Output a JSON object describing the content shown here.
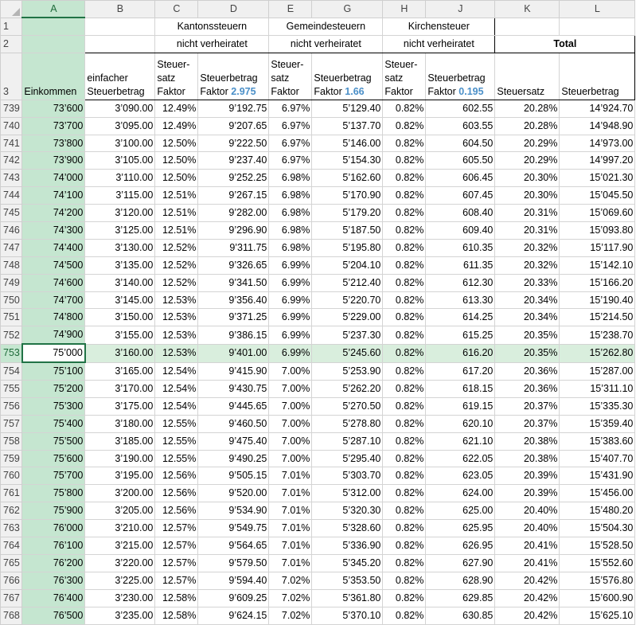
{
  "sheet": {
    "columns": [
      "A",
      "B",
      "C",
      "D",
      "E",
      "G",
      "H",
      "J",
      "K",
      "L"
    ],
    "header_rows": [
      "1",
      "2",
      "3"
    ],
    "group_titles": {
      "kanton": "Kantonssteuern",
      "gemeinde": "Gemeindesteuern",
      "kirche": "Kirchensteuer"
    },
    "group_subtitle": "nicht verheiratet",
    "total_label": "Total",
    "headers": {
      "einkommen": "Einkommen",
      "einfach_1": "einfacher",
      "einfach_2": "Steuerbetrag",
      "satz_1": "Steuer-",
      "satz_2": "satz",
      "satz_3": "Faktor",
      "betrag_1": "Steuerbetrag",
      "betrag_2": "Faktor",
      "faktor_kanton": "2.975",
      "faktor_gemeinde": "1.66",
      "faktor_kirche": "0.195",
      "steuersatz": "Steuersatz",
      "steuerbetrag": "Steuerbetrag"
    },
    "active_row": "753",
    "rows": [
      [
        "739",
        "73’600",
        "3’090.00",
        "12.49%",
        "9’192.75",
        "6.97%",
        "5’129.40",
        "0.82%",
        "602.55",
        "20.28%",
        "14’924.70"
      ],
      [
        "740",
        "73’700",
        "3’095.00",
        "12.49%",
        "9’207.65",
        "6.97%",
        "5’137.70",
        "0.82%",
        "603.55",
        "20.28%",
        "14’948.90"
      ],
      [
        "741",
        "73’800",
        "3’100.00",
        "12.50%",
        "9’222.50",
        "6.97%",
        "5’146.00",
        "0.82%",
        "604.50",
        "20.29%",
        "14’973.00"
      ],
      [
        "742",
        "73’900",
        "3’105.00",
        "12.50%",
        "9’237.40",
        "6.97%",
        "5’154.30",
        "0.82%",
        "605.50",
        "20.29%",
        "14’997.20"
      ],
      [
        "743",
        "74’000",
        "3’110.00",
        "12.50%",
        "9’252.25",
        "6.98%",
        "5’162.60",
        "0.82%",
        "606.45",
        "20.30%",
        "15’021.30"
      ],
      [
        "744",
        "74’100",
        "3’115.00",
        "12.51%",
        "9’267.15",
        "6.98%",
        "5’170.90",
        "0.82%",
        "607.45",
        "20.30%",
        "15’045.50"
      ],
      [
        "745",
        "74’200",
        "3’120.00",
        "12.51%",
        "9’282.00",
        "6.98%",
        "5’179.20",
        "0.82%",
        "608.40",
        "20.31%",
        "15’069.60"
      ],
      [
        "746",
        "74’300",
        "3’125.00",
        "12.51%",
        "9’296.90",
        "6.98%",
        "5’187.50",
        "0.82%",
        "609.40",
        "20.31%",
        "15’093.80"
      ],
      [
        "747",
        "74’400",
        "3’130.00",
        "12.52%",
        "9’311.75",
        "6.98%",
        "5’195.80",
        "0.82%",
        "610.35",
        "20.32%",
        "15’117.90"
      ],
      [
        "748",
        "74’500",
        "3’135.00",
        "12.52%",
        "9’326.65",
        "6.99%",
        "5’204.10",
        "0.82%",
        "611.35",
        "20.32%",
        "15’142.10"
      ],
      [
        "749",
        "74’600",
        "3’140.00",
        "12.52%",
        "9’341.50",
        "6.99%",
        "5’212.40",
        "0.82%",
        "612.30",
        "20.33%",
        "15’166.20"
      ],
      [
        "750",
        "74’700",
        "3’145.00",
        "12.53%",
        "9’356.40",
        "6.99%",
        "5’220.70",
        "0.82%",
        "613.30",
        "20.34%",
        "15’190.40"
      ],
      [
        "751",
        "74’800",
        "3’150.00",
        "12.53%",
        "9’371.25",
        "6.99%",
        "5’229.00",
        "0.82%",
        "614.25",
        "20.34%",
        "15’214.50"
      ],
      [
        "752",
        "74’900",
        "3’155.00",
        "12.53%",
        "9’386.15",
        "6.99%",
        "5’237.30",
        "0.82%",
        "615.25",
        "20.35%",
        "15’238.70"
      ],
      [
        "753",
        "75’000",
        "3’160.00",
        "12.53%",
        "9’401.00",
        "6.99%",
        "5’245.60",
        "0.82%",
        "616.20",
        "20.35%",
        "15’262.80"
      ],
      [
        "754",
        "75’100",
        "3’165.00",
        "12.54%",
        "9’415.90",
        "7.00%",
        "5’253.90",
        "0.82%",
        "617.20",
        "20.36%",
        "15’287.00"
      ],
      [
        "755",
        "75’200",
        "3’170.00",
        "12.54%",
        "9’430.75",
        "7.00%",
        "5’262.20",
        "0.82%",
        "618.15",
        "20.36%",
        "15’311.10"
      ],
      [
        "756",
        "75’300",
        "3’175.00",
        "12.54%",
        "9’445.65",
        "7.00%",
        "5’270.50",
        "0.82%",
        "619.15",
        "20.37%",
        "15’335.30"
      ],
      [
        "757",
        "75’400",
        "3’180.00",
        "12.55%",
        "9’460.50",
        "7.00%",
        "5’278.80",
        "0.82%",
        "620.10",
        "20.37%",
        "15’359.40"
      ],
      [
        "758",
        "75’500",
        "3’185.00",
        "12.55%",
        "9’475.40",
        "7.00%",
        "5’287.10",
        "0.82%",
        "621.10",
        "20.38%",
        "15’383.60"
      ],
      [
        "759",
        "75’600",
        "3’190.00",
        "12.55%",
        "9’490.25",
        "7.00%",
        "5’295.40",
        "0.82%",
        "622.05",
        "20.38%",
        "15’407.70"
      ],
      [
        "760",
        "75’700",
        "3’195.00",
        "12.56%",
        "9’505.15",
        "7.01%",
        "5’303.70",
        "0.82%",
        "623.05",
        "20.39%",
        "15’431.90"
      ],
      [
        "761",
        "75’800",
        "3’200.00",
        "12.56%",
        "9’520.00",
        "7.01%",
        "5’312.00",
        "0.82%",
        "624.00",
        "20.39%",
        "15’456.00"
      ],
      [
        "762",
        "75’900",
        "3’205.00",
        "12.56%",
        "9’534.90",
        "7.01%",
        "5’320.30",
        "0.82%",
        "625.00",
        "20.40%",
        "15’480.20"
      ],
      [
        "763",
        "76’000",
        "3’210.00",
        "12.57%",
        "9’549.75",
        "7.01%",
        "5’328.60",
        "0.82%",
        "625.95",
        "20.40%",
        "15’504.30"
      ],
      [
        "764",
        "76’100",
        "3’215.00",
        "12.57%",
        "9’564.65",
        "7.01%",
        "5’336.90",
        "0.82%",
        "626.95",
        "20.41%",
        "15’528.50"
      ],
      [
        "765",
        "76’200",
        "3’220.00",
        "12.57%",
        "9’579.50",
        "7.01%",
        "5’345.20",
        "0.82%",
        "627.90",
        "20.41%",
        "15’552.60"
      ],
      [
        "766",
        "76’300",
        "3’225.00",
        "12.57%",
        "9’594.40",
        "7.02%",
        "5’353.50",
        "0.82%",
        "628.90",
        "20.42%",
        "15’576.80"
      ],
      [
        "767",
        "76’400",
        "3’230.00",
        "12.58%",
        "9’609.25",
        "7.02%",
        "5’361.80",
        "0.82%",
        "629.85",
        "20.42%",
        "15’600.90"
      ],
      [
        "768",
        "76’500",
        "3’235.00",
        "12.58%",
        "9’624.15",
        "7.02%",
        "5’370.10",
        "0.82%",
        "630.85",
        "20.42%",
        "15’625.10"
      ]
    ]
  }
}
